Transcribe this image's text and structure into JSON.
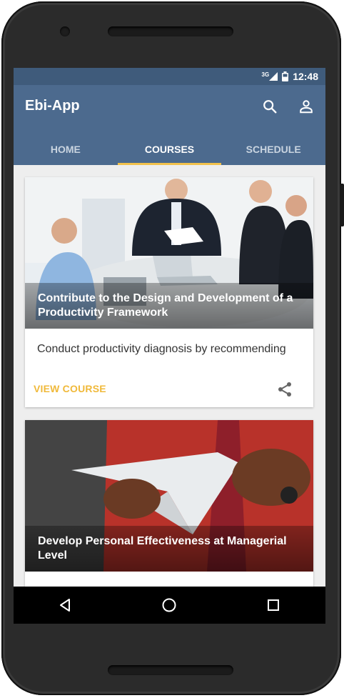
{
  "status": {
    "network": "3G",
    "time": "12:48"
  },
  "appbar": {
    "title": "Ebi-App",
    "icons": [
      "search-icon",
      "account-icon"
    ]
  },
  "tabs": [
    {
      "label": "HOME",
      "active": false
    },
    {
      "label": "COURSES",
      "active": true
    },
    {
      "label": "SCHEDULE",
      "active": false
    }
  ],
  "courses": [
    {
      "title": "Contribute to the Design and Development of a Productivity Framework",
      "description": "Conduct productivity diagnosis by recommending",
      "action": "VIEW COURSE",
      "share_icon": "share-icon"
    },
    {
      "title": "Develop Personal Effectiveness at Managerial Level"
    }
  ],
  "colors": {
    "status": "#3f5b7b",
    "appbar": "#4c6a8e",
    "accent": "#f2c14b",
    "link": "#f0b93a"
  },
  "navbar": {
    "icons": [
      "back-icon",
      "home-icon",
      "recents-icon"
    ]
  }
}
